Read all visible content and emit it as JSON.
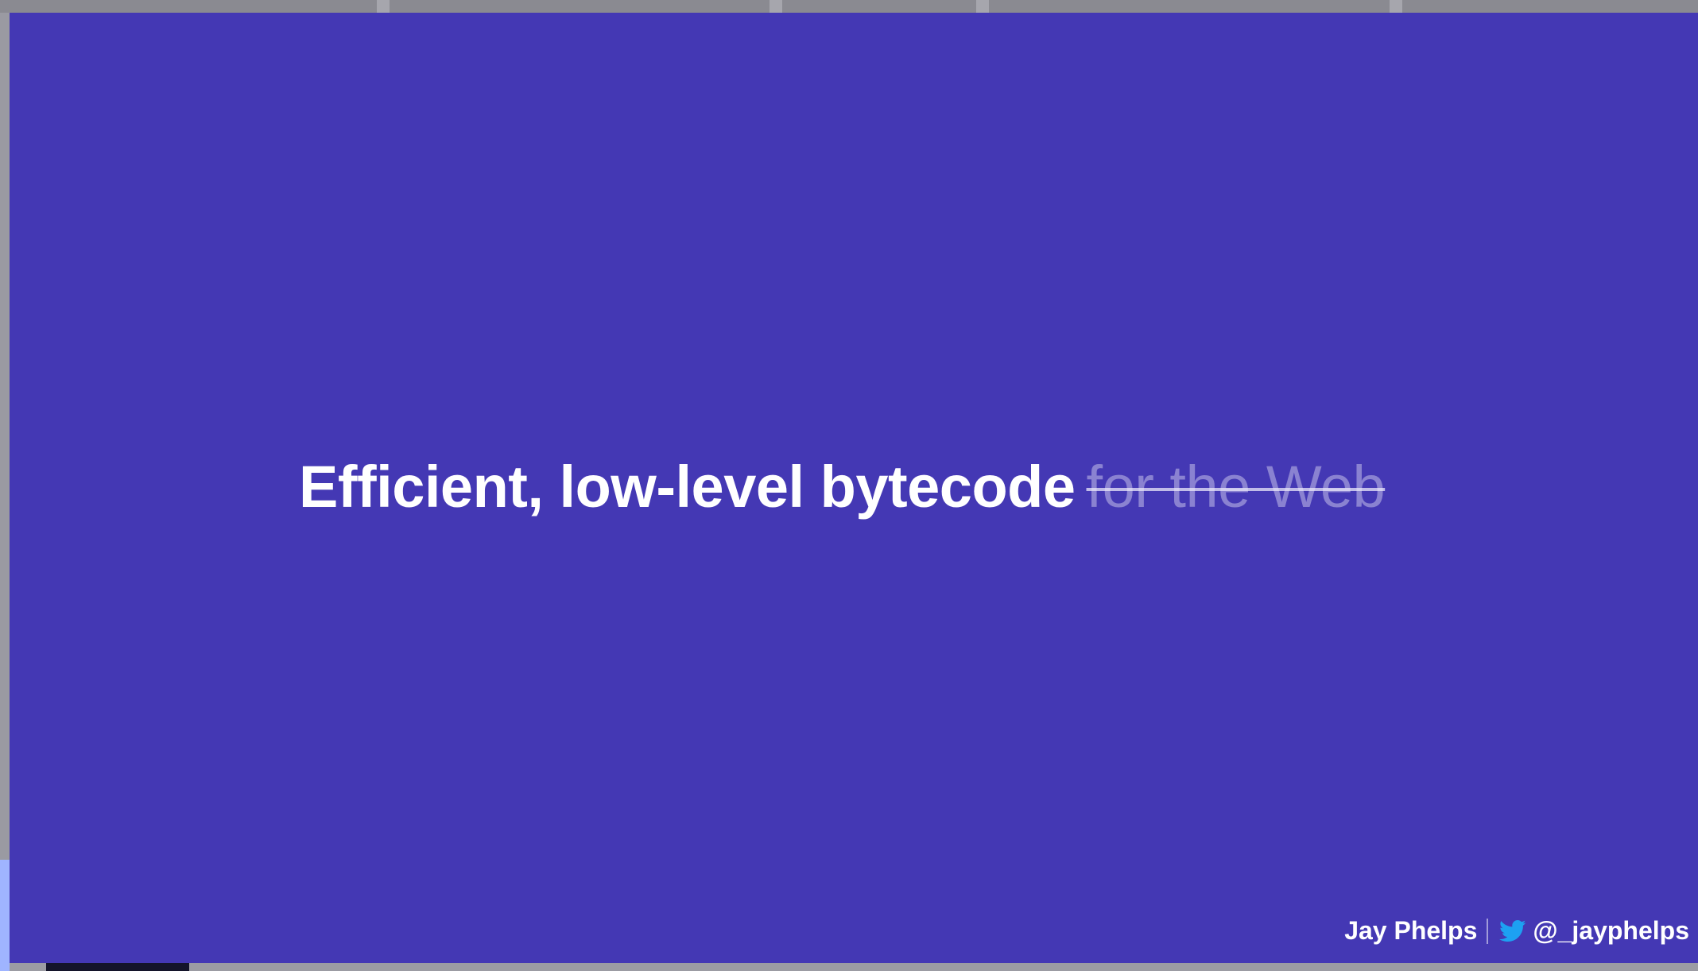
{
  "slide": {
    "headline_main": "Efficient, low-level bytecode",
    "headline_struck": "for the Web",
    "footer": {
      "author": "Jay Phelps",
      "handle": "@_jayphelps",
      "handle_icon": "twitter-bird-icon"
    }
  },
  "colors": {
    "slide_background": "#4438b4",
    "headline_text": "#ffffff",
    "twitter_blue": "#1da1f2"
  }
}
